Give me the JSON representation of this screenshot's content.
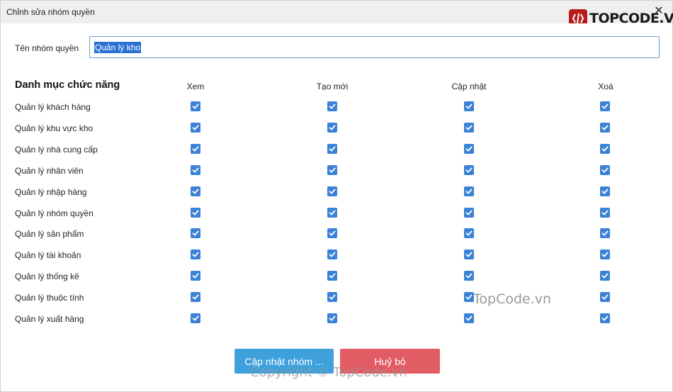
{
  "window": {
    "title": "Chỉnh sửa nhóm quyền",
    "close_glyph": "✕"
  },
  "logo": {
    "text": "TOPCODE.VN",
    "mark_icon": "topcode-logo-icon"
  },
  "form": {
    "name_label": "Tên nhóm quyền",
    "name_value": "Quản lý kho"
  },
  "permissions": {
    "section_title": "Danh mục chức năng",
    "columns": [
      "Xem",
      "Tạo mới",
      "Cập nhật",
      "Xoá"
    ],
    "rows": [
      {
        "label": "Quản lý khách hàng",
        "checked": [
          true,
          true,
          true,
          true
        ]
      },
      {
        "label": "Quản lý khu vực kho",
        "checked": [
          true,
          true,
          true,
          true
        ]
      },
      {
        "label": "Quản lý nhà cung cấp",
        "checked": [
          true,
          true,
          true,
          true
        ]
      },
      {
        "label": "Quản lý nhân viên",
        "checked": [
          true,
          true,
          true,
          true
        ]
      },
      {
        "label": "Quản lý nhập hàng",
        "checked": [
          true,
          true,
          true,
          true
        ]
      },
      {
        "label": "Quản lý nhóm quyền",
        "checked": [
          true,
          true,
          true,
          true
        ]
      },
      {
        "label": "Quản lý sản phẩm",
        "checked": [
          true,
          true,
          true,
          true
        ]
      },
      {
        "label": "Quản lý tài khoản",
        "checked": [
          true,
          true,
          true,
          true
        ]
      },
      {
        "label": "Quản lý thống kê",
        "checked": [
          true,
          true,
          true,
          true
        ]
      },
      {
        "label": "Quản lý thuộc tính",
        "checked": [
          true,
          true,
          true,
          true
        ]
      },
      {
        "label": "Quản lý xuất hàng",
        "checked": [
          true,
          true,
          true,
          true
        ]
      }
    ]
  },
  "buttons": {
    "update": "Cập nhật nhóm ...",
    "cancel": "Huỷ bỏ"
  },
  "watermarks": {
    "center": "TopCode.vn",
    "bottom": "Copyright © TopCode.vn"
  },
  "colors": {
    "checkbox": "#3b82d6",
    "update_button": "#3ea1dc",
    "cancel_button": "#e25c64"
  }
}
